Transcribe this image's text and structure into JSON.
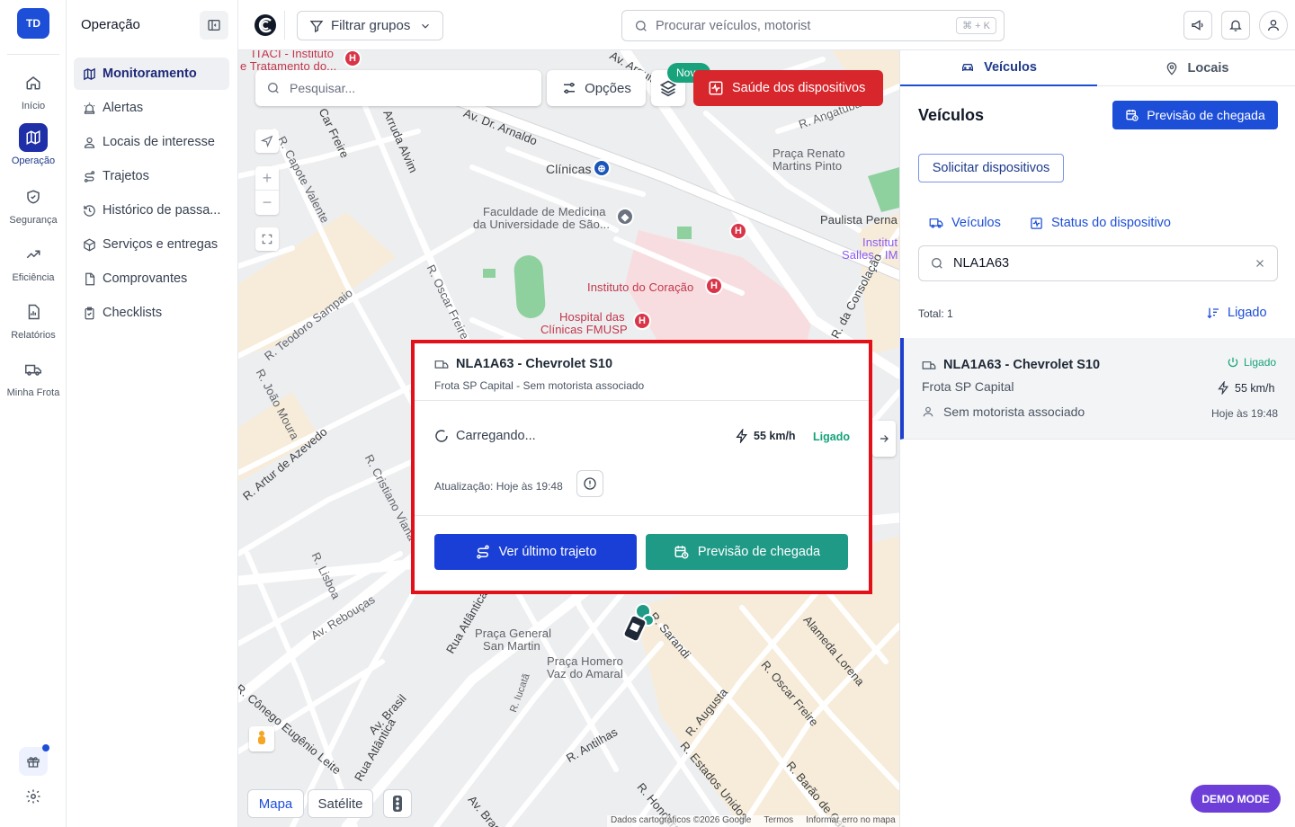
{
  "user": {
    "initials": "TD"
  },
  "rail": {
    "items": [
      {
        "label": "Início",
        "icon": "home-icon"
      },
      {
        "label": "Operação",
        "icon": "map-icon",
        "active": true
      },
      {
        "label": "Segurança",
        "icon": "shield-icon"
      },
      {
        "label": "Eficiência",
        "icon": "trending-up-icon"
      },
      {
        "label": "Relatórios",
        "icon": "report-icon"
      },
      {
        "label": "Minha Frota",
        "icon": "truck-icon"
      }
    ]
  },
  "sidebar": {
    "title": "Operação",
    "items": [
      {
        "label": "Monitoramento",
        "icon": "map-icon",
        "active": true
      },
      {
        "label": "Alertas",
        "icon": "siren-icon"
      },
      {
        "label": "Locais de interesse",
        "icon": "user-pin-icon"
      },
      {
        "label": "Trajetos",
        "icon": "route-icon"
      },
      {
        "label": "Histórico de passa...",
        "icon": "history-icon"
      },
      {
        "label": "Serviços e entregas",
        "icon": "package-icon"
      },
      {
        "label": "Comprovantes",
        "icon": "file-icon"
      },
      {
        "label": "Checklists",
        "icon": "clipboard-icon"
      }
    ]
  },
  "topbar": {
    "filter_label": "Filtrar grupos",
    "search_placeholder": "Procurar veículos, motorist",
    "shortcut": "⌘ + K"
  },
  "map": {
    "search_placeholder": "Pesquisar...",
    "options_label": "Opções",
    "new_badge": "Novo",
    "health_label": "Saúde dos dispositivos",
    "tabs": {
      "map": "Mapa",
      "satellite": "Satélite"
    },
    "attribution": [
      "Dados cartográficos ©2026 Google",
      "Termos",
      "Informar erro no mapa"
    ],
    "labels": {
      "l1": "ITACI - Instituto",
      "l2": "e Tratamento do...",
      "l3": "Av. Dr. Arnaldo",
      "l4": "Clínicas",
      "l5": "Faculdade de Medicina",
      "l6": "da Universidade de São...",
      "l7": "Praça Renato",
      "l8": "Martins Pinto",
      "l9": "Paulista Perna",
      "l10": "Institut",
      "l11": "Salles - IM",
      "l12": "Instituto do Coração",
      "l13": "Hospital das",
      "l14": "Clínicas FMUSP",
      "l15": "R. Teodoro Sampaio",
      "l16": "R. João Moura",
      "l17": "R. Oscar Freire",
      "l18": "R. Capote Valente",
      "l19": "Av. Rebouças",
      "l20": "R. Lisboa",
      "l21": "R. Cristiano Viana",
      "l22": "Praça General",
      "l23": "San Martin",
      "l24": "Praça Homero",
      "l25": "Vaz do Amaral",
      "l26": "R. Sarandi",
      "l27": "Alameda Lorena",
      "l28": "R. Oscar Freire",
      "l29": "R. Augusta",
      "l30": "R. Estados Unidos",
      "l31": "R. Barão de Capanema",
      "l32": "R. Antilhas",
      "l33": "Av. Brasil",
      "l34": "Rua Atlântica",
      "l35": "R. Cônego Eugênio Leite",
      "l36": "Av. Brasil",
      "l37": "Rua Atlântica",
      "l38": "R. Artur de Azevedo",
      "l39": "R. Iucatã",
      "l40": "R. da Consolação",
      "l41": "Arruda Alvim",
      "l42": "Av. Arquit",
      "l43": "R. Angatuba",
      "l44": "Car Freire",
      "l45": "R. Hondura",
      "l46": "H"
    }
  },
  "popup": {
    "title": "NLA1A63 - Chevrolet S10",
    "subtitle": "Frota SP Capital - Sem motorista associado",
    "loading": "Carregando...",
    "speed": "55 km/h",
    "status": "Ligado",
    "updated": "Atualização: Hoje às 19:48",
    "route_button": "Ver último trajeto",
    "eta_button": "Previsão de chegada"
  },
  "right": {
    "tabs": {
      "vehicles": "Veículos",
      "places": "Locais"
    },
    "title": "Veículos",
    "eta_button": "Previsão de chegada",
    "request_button": "Solicitar dispositivos",
    "subtabs": {
      "vehicles": "Veículos",
      "device_status": "Status do dispositivo"
    },
    "search_value": "NLA1A63",
    "total": "Total: 1",
    "sort_label": "Ligado",
    "card": {
      "title": "NLA1A63 - Chevrolet S10",
      "status": "Ligado",
      "fleet": "Frota SP Capital",
      "speed": "55 km/h",
      "driver": "Sem motorista associado",
      "time": "Hoje às 19:48"
    }
  },
  "demo_badge": "DEMO MODE",
  "colors": {
    "primary": "#1d4ed8",
    "danger": "#d7262c",
    "success": "#16a37a",
    "teal": "#1f9a87",
    "demo": "#6d3fd8"
  }
}
